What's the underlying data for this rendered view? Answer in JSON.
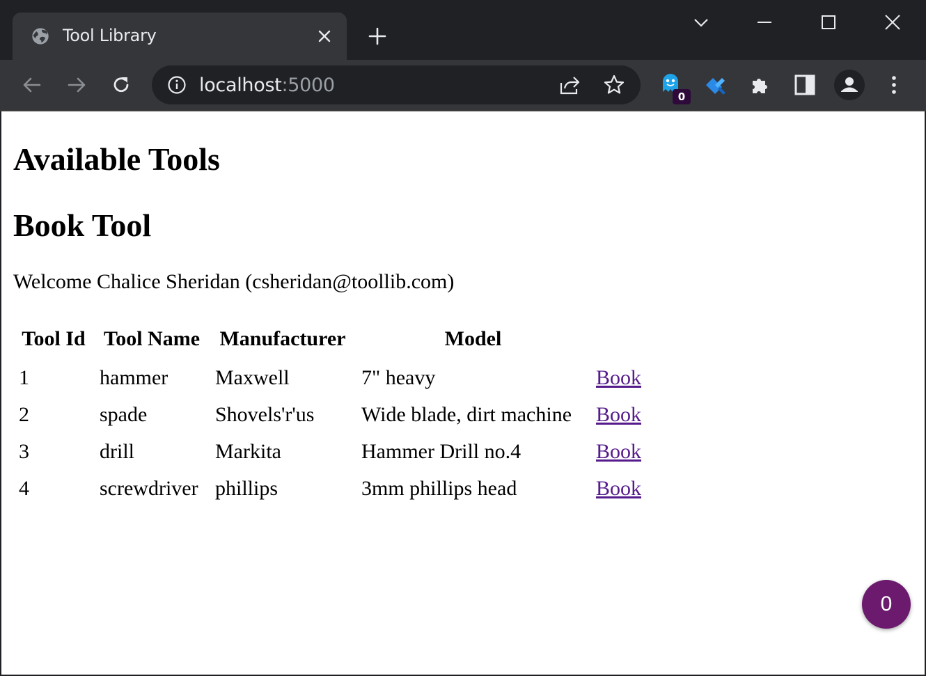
{
  "browser": {
    "tab_title": "Tool Library",
    "url_host": "localhost",
    "url_port": ":5000",
    "extension_badge": "0"
  },
  "page": {
    "heading_available": "Available Tools",
    "heading_book": "Book Tool",
    "welcome": "Welcome Chalice Sheridan (csheridan@toollib.com)",
    "table": {
      "headers": [
        "Tool Id",
        "Tool Name",
        "Manufacturer",
        "Model",
        ""
      ],
      "rows": [
        {
          "id": "1",
          "name": "hammer",
          "manufacturer": "Maxwell",
          "model": "7\" heavy",
          "action": "Book"
        },
        {
          "id": "2",
          "name": "spade",
          "manufacturer": "Shovels'r'us",
          "model": "Wide blade, dirt machine",
          "action": "Book"
        },
        {
          "id": "3",
          "name": "drill",
          "manufacturer": "Markita",
          "model": "Hammer Drill no.4",
          "action": "Book"
        },
        {
          "id": "4",
          "name": "screwdriver",
          "manufacturer": "phillips",
          "model": "3mm phillips head",
          "action": "Book"
        }
      ]
    },
    "cart_count": "0"
  },
  "colors": {
    "tab_strip": "#202124",
    "toolbar": "#35363a",
    "link": "#551a8b",
    "cart_button": "#6b1a6e"
  }
}
